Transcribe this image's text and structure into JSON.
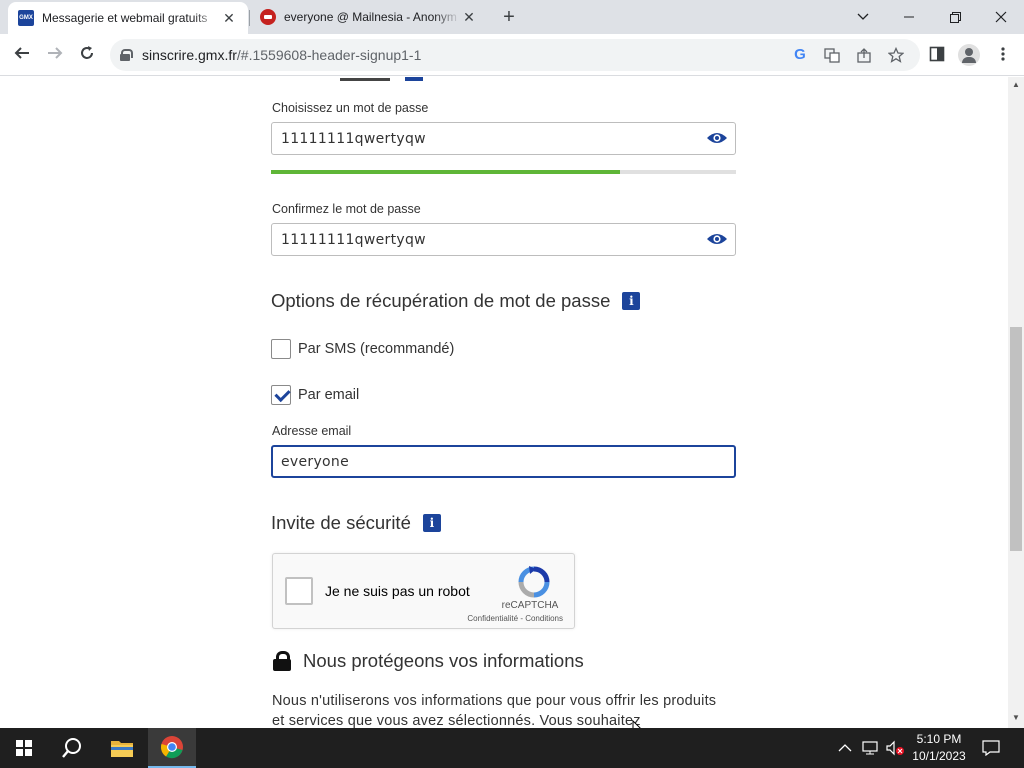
{
  "browser": {
    "tabs": [
      {
        "title": "Messagerie et webmail gratuits",
        "favicon": "gmx-icon",
        "active": true
      },
      {
        "title": "everyone @ Mailnesia - Anonym",
        "favicon": "mailnesia-icon",
        "active": false
      }
    ],
    "address": {
      "host": "sinscrire.gmx.fr",
      "path": "/#.1559608-header-signup1-1"
    }
  },
  "form": {
    "password_label": "Choisissez un mot de passe",
    "password_value": "11111111qwertyqw",
    "password_strength": 0.75,
    "confirm_label": "Confirmez le mot de passe",
    "confirm_value": "11111111qwertyqw",
    "recovery_title": "Options de récupération de mot de passe",
    "info_glyph": "i",
    "sms_label": "Par SMS (recommandé)",
    "sms_checked": false,
    "email_option_label": "Par email",
    "email_option_checked": true,
    "email_label": "Adresse email",
    "email_value": "everyone",
    "security_title": "Invite de sécurité",
    "captcha": {
      "text": "Je ne suis pas un robot",
      "brand": "reCAPTCHA",
      "links": "Confidentialité - Conditions"
    },
    "protect_title": "Nous protégeons vos informations",
    "protect_text": "Nous n'utiliserons vos informations que pour vous offrir les produits et services que vous avez sélectionnés. Vous souhaitez"
  },
  "taskbar": {
    "time": "5:10 PM",
    "date": "10/1/2023"
  },
  "colors": {
    "accent": "#1c449b",
    "strength": "#5fb637"
  }
}
